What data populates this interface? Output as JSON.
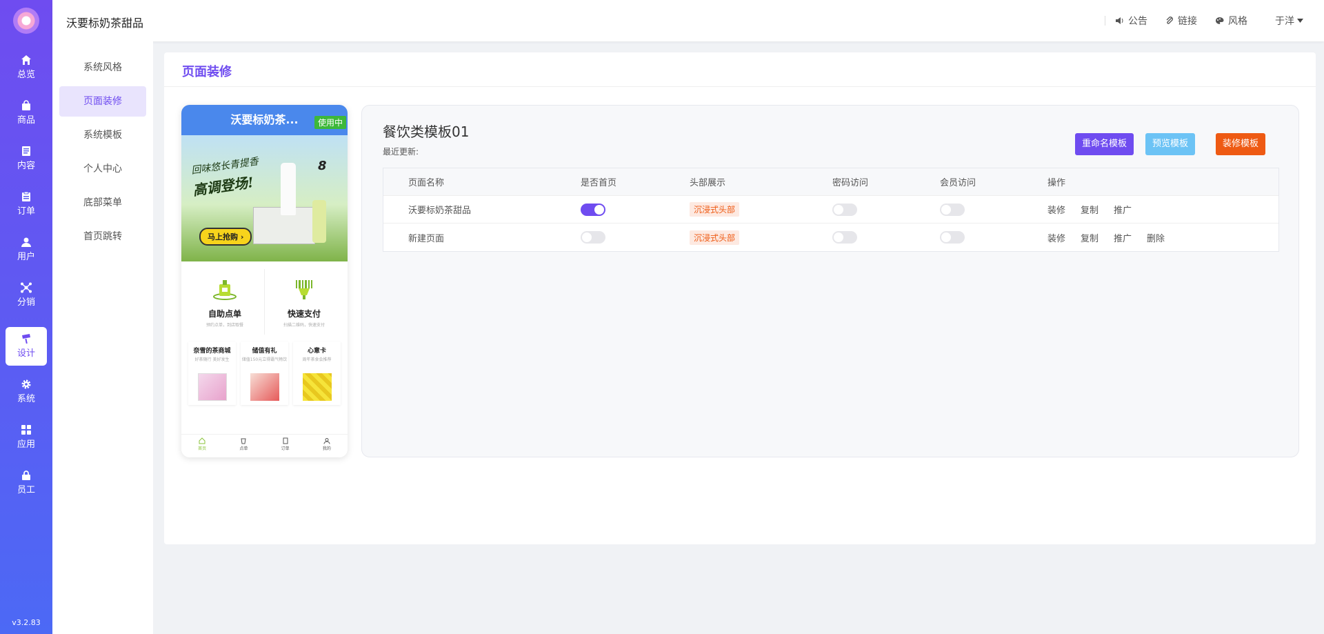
{
  "app": {
    "shop_name": "沃要标奶茶甜品",
    "version": "v3.2.83",
    "colors": {
      "primary": "#6f4cf0",
      "info": "#6cc3f5",
      "warning": "#ee5a13"
    }
  },
  "rail": {
    "items": [
      {
        "label": "总览",
        "icon": "home-icon"
      },
      {
        "label": "商品",
        "icon": "bag-icon"
      },
      {
        "label": "内容",
        "icon": "document-icon"
      },
      {
        "label": "订单",
        "icon": "clipboard-icon"
      },
      {
        "label": "用户",
        "icon": "user-icon"
      },
      {
        "label": "分销",
        "icon": "network-icon"
      },
      {
        "label": "设计",
        "icon": "brush-icon",
        "active": true
      },
      {
        "label": "系统",
        "icon": "gear-icon"
      },
      {
        "label": "应用",
        "icon": "grid-icon"
      },
      {
        "label": "员工",
        "icon": "lock-icon"
      }
    ]
  },
  "topbar": {
    "announce": "公告",
    "links": "链接",
    "style": "风格",
    "user": "于洋"
  },
  "subnav": {
    "items": [
      {
        "label": "系统风格"
      },
      {
        "label": "页面装修",
        "active": true
      },
      {
        "label": "系统模板"
      },
      {
        "label": "个人中心"
      },
      {
        "label": "底部菜单"
      },
      {
        "label": "首页跳转"
      }
    ]
  },
  "page": {
    "title": "页面装修"
  },
  "phone": {
    "title": "沃要标奶茶...",
    "badge": "使用中",
    "banner": {
      "line1": "回味悠长青提香",
      "line2": "高调登场!",
      "button": "马上抢购",
      "number": "8"
    },
    "actions": [
      {
        "title": "自助点单",
        "sub": "预约点单，到店取餐"
      },
      {
        "title": "快速支付",
        "sub": "扫描二维码，快速支付"
      }
    ],
    "cards": [
      {
        "title": "奈雪的茶商城",
        "sub": "好茶随行 美好发生"
      },
      {
        "title": "储值有礼",
        "sub": "储值150元立得霸气畅饮"
      },
      {
        "title": "心意卡",
        "sub": "周年茶食会推荐"
      }
    ],
    "tabs": [
      {
        "label": "首页",
        "icon": "home-icon"
      },
      {
        "label": "点单",
        "icon": "cup-icon"
      },
      {
        "label": "订单",
        "icon": "order-icon"
      },
      {
        "label": "我的",
        "icon": "person-icon"
      }
    ]
  },
  "template": {
    "name": "餐饮类模板01",
    "updated_label": "最近更新:",
    "buttons": {
      "rename": "重命名模板",
      "preview": "预览模板",
      "decorate": "装修模板"
    },
    "table": {
      "headers": [
        "页面名称",
        "是否首页",
        "头部展示",
        "密码访问",
        "会员访问",
        "操作"
      ],
      "rows": [
        {
          "name": "沃要标奶茶甜品",
          "is_home": true,
          "header": "沉浸式头部",
          "password": false,
          "member": false,
          "ops": [
            "装修",
            "复制",
            "推广"
          ]
        },
        {
          "name": "新建页面",
          "is_home": false,
          "header": "沉浸式头部",
          "password": false,
          "member": false,
          "ops": [
            "装修",
            "复制",
            "推广",
            "删除"
          ]
        }
      ]
    }
  }
}
